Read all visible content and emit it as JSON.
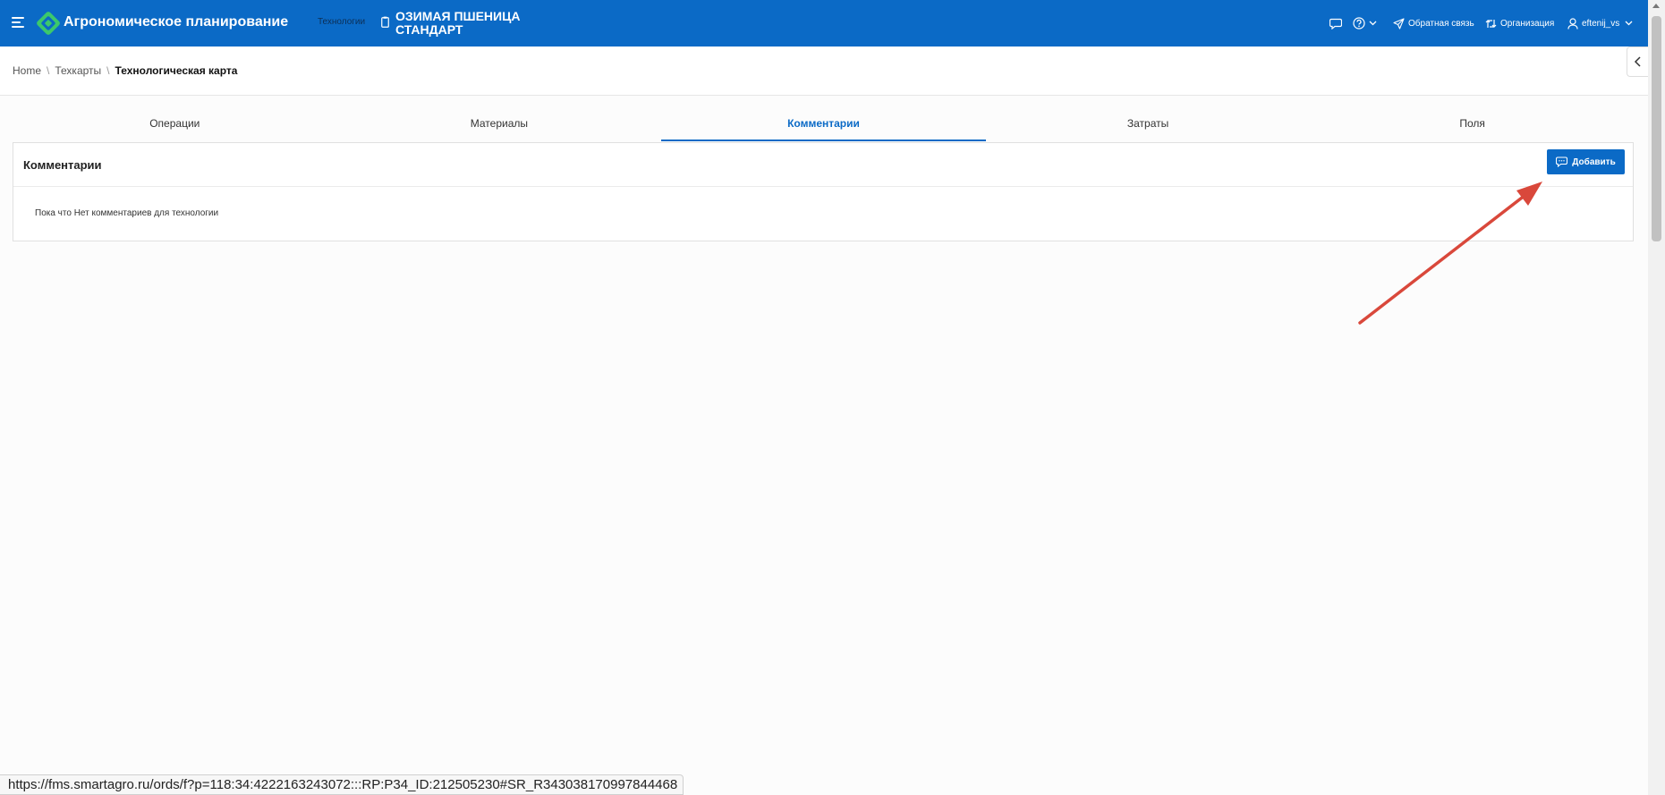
{
  "header": {
    "app_title": "Агрономическое планирование",
    "section_label": "Технологии",
    "tech_name_line1": "ОЗИМАЯ ПШЕНИЦА",
    "tech_name_line2": "СТАНДАРТ",
    "feedback_label": "Обратная связь",
    "organization_label": "Организация",
    "user_label": "eftenij_vs",
    "bg_color": "#0b6ac6"
  },
  "breadcrumb": {
    "home": "Home",
    "techcards": "Техкарты",
    "current": "Технологическая карта"
  },
  "tabs": [
    {
      "label": "Операции"
    },
    {
      "label": "Материалы"
    },
    {
      "label": "Комментарии",
      "active": true
    },
    {
      "label": "Затраты"
    },
    {
      "label": "Поля"
    }
  ],
  "panel": {
    "title": "Комментарии",
    "add_button_label": "Добавить",
    "empty_message": "Пока что Нет комментариев для технологии"
  },
  "status_url": "https://fms.smartagro.ru/ords/f?p=118:34:4222163243072:::RP:P34_ID:212505230#SR_R343038170997844468",
  "icons": {
    "menu": "hamburger-menu-icon",
    "logo": "leaf-logo-icon",
    "chat": "chat-icon",
    "help": "help-icon",
    "feedback": "paper-plane-icon",
    "organization": "switch-arrows-icon",
    "user": "user-icon"
  },
  "annotation_color": "#d9483b"
}
